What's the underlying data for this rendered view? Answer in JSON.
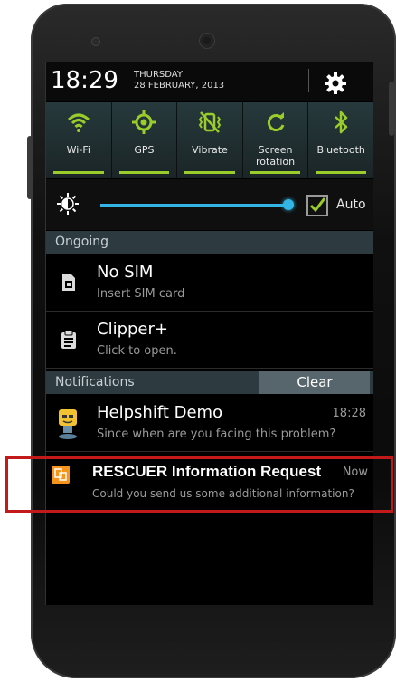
{
  "status": {
    "time": "18:29",
    "day": "THURSDAY",
    "date": "28 FEBRUARY, 2013"
  },
  "toggles": [
    {
      "label": "Wi-Fi",
      "icon": "wifi-icon"
    },
    {
      "label": "GPS",
      "icon": "gps-icon"
    },
    {
      "label": "Vibrate",
      "icon": "vibrate-icon"
    },
    {
      "label": "Screen rotation",
      "icon": "rotation-icon"
    },
    {
      "label": "Bluetooth",
      "icon": "bluetooth-icon"
    }
  ],
  "brightness": {
    "auto_label": "Auto",
    "auto_checked": true,
    "level": 0.94
  },
  "ongoing": {
    "header": "Ongoing",
    "items": [
      {
        "title": "No SIM",
        "subtitle": "Insert SIM card",
        "icon": "sim-icon"
      },
      {
        "title": "Clipper+",
        "subtitle": "Click to open.",
        "icon": "clipboard-icon"
      }
    ]
  },
  "notifications": {
    "header": "Notifications",
    "clear_label": "Clear",
    "items": [
      {
        "title": "Helpshift Demo",
        "subtitle": "Since when are you facing this problem?",
        "time": "18:28",
        "icon": "helpshift-icon"
      },
      {
        "title": "RESCUER Information Request",
        "subtitle": "Could you send us some additional information?",
        "time": "Now",
        "icon": "rescuer-icon"
      }
    ]
  },
  "colors": {
    "accent": "#33b5e5",
    "toggle_on": "#9acd2a",
    "highlight": "#c21a1a"
  }
}
